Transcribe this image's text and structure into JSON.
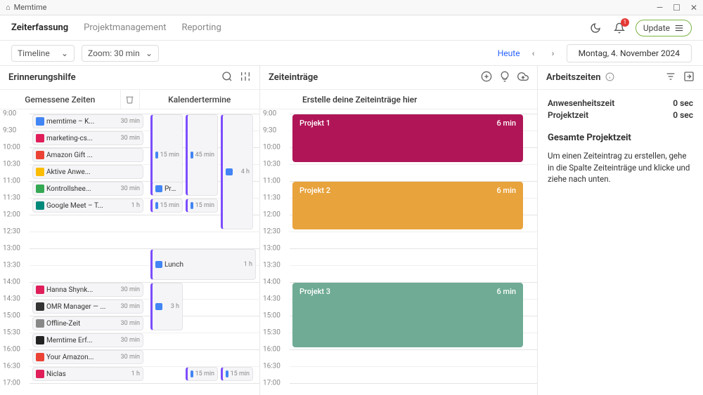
{
  "app": {
    "name": "Memtime"
  },
  "nav": {
    "tabs": [
      "Zeiterfassung",
      "Projektmanagement",
      "Reporting"
    ],
    "active": 0,
    "update": "Update",
    "notification_count": "1"
  },
  "controls": {
    "view": "Timeline",
    "zoom": "Zoom: 30 min",
    "today": "Heute",
    "date": "Montag, 4. November 2024"
  },
  "panels": {
    "reminder": {
      "title": "Erinnerungshilfe",
      "measured": "Gemessene Zeiten",
      "calendar": "Kalendertermine"
    },
    "entries": {
      "title": "Zeiteinträge",
      "hint": "Erstelle deine Zeiteinträge hier"
    },
    "work": {
      "title": "Arbeitszeiten"
    }
  },
  "time_slots": [
    "9:00",
    "9:30",
    "10:00",
    "10:30",
    "11:00",
    "11:30",
    "12:00",
    "12:30",
    "13:00",
    "13:30",
    "14:00",
    "14:30",
    "15:00",
    "15:30",
    "16:00",
    "16:30",
    "17:00"
  ],
  "measured": [
    {
      "row": 0,
      "icon": "#4285f4",
      "name": "memtime – K...",
      "dur": "30 min"
    },
    {
      "row": 1,
      "icon": "#e01e5a",
      "name": "marketing-cs...",
      "dur": "30 min"
    },
    {
      "row": 2,
      "icon": "#ea4335",
      "name": "Amazon Gift ...",
      "dur": ""
    },
    {
      "row": 3,
      "icon": "#fbbc04",
      "name": "Aktive Anwe...",
      "dur": ""
    },
    {
      "row": 4,
      "icon": "#34a853",
      "name": "Kontrollshee...",
      "dur": "30 min"
    },
    {
      "row": 5,
      "icon": "#00897b",
      "name": "Google Meet – T...",
      "dur": "1 h"
    },
    {
      "row": 10,
      "icon": "#e01e5a",
      "name": "Hanna Shynk...",
      "dur": "30 min"
    },
    {
      "row": 11,
      "icon": "#333",
      "name": "OMR Manager — ...",
      "dur": "30 min"
    },
    {
      "row": 12,
      "icon": "#888",
      "name": "Offline-Zeit",
      "dur": "30 min"
    },
    {
      "row": 13,
      "icon": "#222",
      "name": "Memtime Erf...",
      "dur": "30 min"
    },
    {
      "row": 14,
      "icon": "#ea4335",
      "name": "Your Amazon...",
      "dur": "30 min"
    },
    {
      "row": 15,
      "icon": "#e01e5a",
      "name": "Niclas",
      "dur": "1 h"
    }
  ],
  "cal_events": [
    {
      "row": 0,
      "span": 5,
      "col": 0,
      "dur": "15 min",
      "big": false
    },
    {
      "row": 0,
      "span": 5,
      "col": 1,
      "dur": "45 min",
      "big": false
    },
    {
      "row": 0,
      "span": 7,
      "col": 2,
      "dur": "4 h",
      "big": false
    },
    {
      "row": 4,
      "span": 1,
      "col": 0,
      "dur": "",
      "name": "Prep...",
      "big": true
    },
    {
      "row": 5,
      "span": 1,
      "col": 0,
      "dur": "15 min",
      "big": false
    },
    {
      "row": 5,
      "span": 1,
      "col": 1,
      "dur": "15 min",
      "big": false
    },
    {
      "row": 8,
      "span": 2,
      "col": 0,
      "dur": "1 h",
      "name": "Lunch",
      "big": true,
      "full": true
    },
    {
      "row": 10,
      "span": 3,
      "col": 0,
      "dur": "3 h",
      "big": true
    },
    {
      "row": 15,
      "span": 1,
      "col": 1,
      "dur": "15 min",
      "big": false
    },
    {
      "row": 15,
      "span": 1,
      "col": 2,
      "dur": "15 min",
      "big": false
    }
  ],
  "entries": [
    {
      "row": 0,
      "span": 3,
      "name": "Projekt 1",
      "dur": "6 min",
      "color": "pink"
    },
    {
      "row": 4,
      "span": 3,
      "name": "Projekt 2",
      "dur": "6 min",
      "color": "orange"
    },
    {
      "row": 10,
      "span": 4,
      "name": "Projekt 3",
      "dur": "6 min",
      "color": "teal"
    }
  ],
  "worktimes": {
    "presence_label": "Anwesenheitszeit",
    "presence_val": "0 sec",
    "project_label": "Projektzeit",
    "project_val": "0 sec",
    "total_title": "Gesamte Projektzeit",
    "hint": "Um einen Zeiteintrag zu erstellen, gehe in die Spalte Zeiteinträge und klicke und ziehe nach unten."
  }
}
